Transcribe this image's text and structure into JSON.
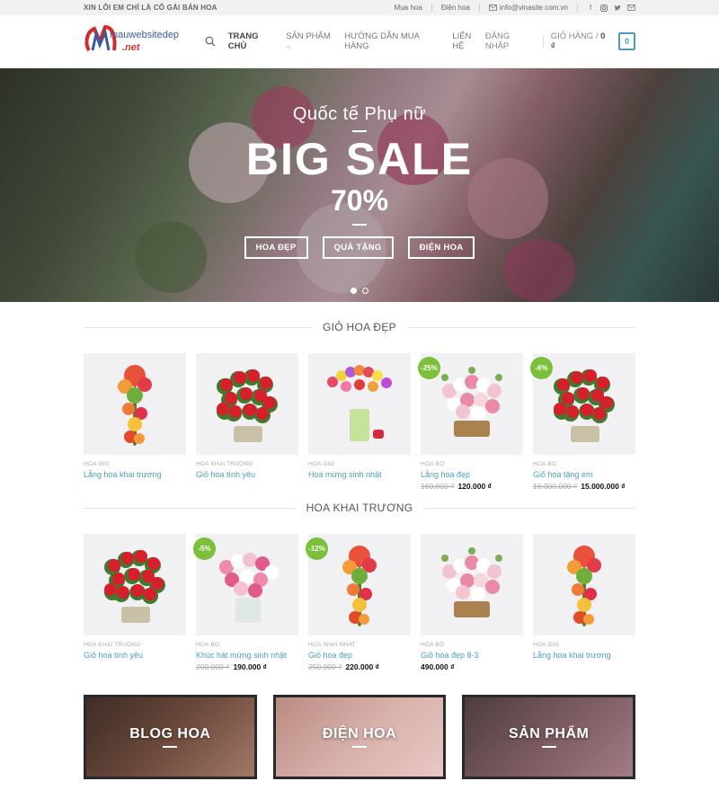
{
  "topbar": {
    "announcement": "XIN LỖI EM CHỈ LÀ CÔ GÁI BÁN HOA",
    "links": [
      "Mua hoa",
      "Điện hoa"
    ],
    "email": "info@vinasite.com.vn",
    "social_icons": [
      "facebook-icon",
      "instagram-icon",
      "twitter-icon",
      "mail-icon"
    ]
  },
  "header": {
    "logo_top": "mauwebsitedep",
    "logo_bottom": ".net",
    "nav": [
      {
        "label": "TRANG CHỦ",
        "active": true
      },
      {
        "label": "SẢN PHẨM",
        "dropdown": true
      },
      {
        "label": "HƯỚNG DẪN MUA HÀNG"
      },
      {
        "label": "LIÊN HỆ"
      }
    ],
    "login": "ĐĂNG NHẬP",
    "cart_label": "GIỎ HÀNG /",
    "cart_total": "0 ₫",
    "cart_count": "0"
  },
  "hero": {
    "subtitle": "Quốc tế Phụ nữ",
    "title": "BIG SALE",
    "discount": "70%",
    "buttons": [
      "HOA ĐẸP",
      "QUÀ TẶNG",
      "ĐIỆN HOA"
    ],
    "slides": 2,
    "active_slide": 1
  },
  "sections": [
    {
      "title": "GIỎ HOA ĐẸP",
      "products": [
        {
          "category": "HOA GIO",
          "name": "Lẵng hoa khai trương",
          "price": "",
          "old_price": "",
          "badge": "",
          "image": "tall-stand-flowers"
        },
        {
          "category": "HOA KHAI TRUONG",
          "name": "Giỏ hoa tình yêu",
          "price": "",
          "old_price": "",
          "badge": "",
          "image": "red-roses-basket"
        },
        {
          "category": "HOA GIO",
          "name": "Họa mừng sinh nhật",
          "price": "",
          "old_price": "",
          "badge": "",
          "image": "tulips-vase"
        },
        {
          "category": "HOA BO",
          "name": "Lẵng hoa đẹp",
          "price": "120.000 ₫",
          "old_price": "160.000 ₫",
          "badge": "-25%",
          "image": "pink-white-basket"
        },
        {
          "category": "HOA BO",
          "name": "Giỏ hoa tặng em",
          "price": "15.000.000 ₫",
          "old_price": "16.000.000 ₫",
          "badge": "-6%",
          "image": "red-roses-basket"
        }
      ]
    },
    {
      "title": "HOA KHAI TRƯƠNG",
      "products": [
        {
          "category": "HOA KHAI TRUONG",
          "name": "Giỏ hoa tình yêu",
          "price": "",
          "old_price": "",
          "badge": "",
          "image": "red-roses-basket"
        },
        {
          "category": "HOA BO",
          "name": "Khúc hát mừng sinh nhật",
          "price": "190.000 ₫",
          "old_price": "200.000 ₫",
          "badge": "-5%",
          "image": "pink-roses-vase"
        },
        {
          "category": "HOA SINH NHAT",
          "name": "Giỏ hoa đẹp",
          "price": "220.000 ₫",
          "old_price": "250.000 ₫",
          "badge": "-12%",
          "image": "tall-stand-flowers"
        },
        {
          "category": "HOA BO",
          "name": "Giỏ hoa đẹp 8-3",
          "price": "490.000 ₫",
          "old_price": "",
          "badge": "",
          "image": "pink-white-basket"
        },
        {
          "category": "HOA GIO",
          "name": "Lẵng hoa khai trương",
          "price": "",
          "old_price": "",
          "badge": "",
          "image": "tall-stand-flowers"
        }
      ]
    }
  ],
  "banners": [
    {
      "title": "BLOG HOA",
      "colors": [
        "#3d2a25",
        "#6b4a3c",
        "#a57a68"
      ]
    },
    {
      "title": "ĐIỆN HOA",
      "colors": [
        "#b88a80",
        "#d8b0aa",
        "#e9c8c4"
      ]
    },
    {
      "title": "SẢN PHẨM",
      "colors": [
        "#4a3b3c",
        "#7a5a60",
        "#a47d86"
      ]
    }
  ]
}
